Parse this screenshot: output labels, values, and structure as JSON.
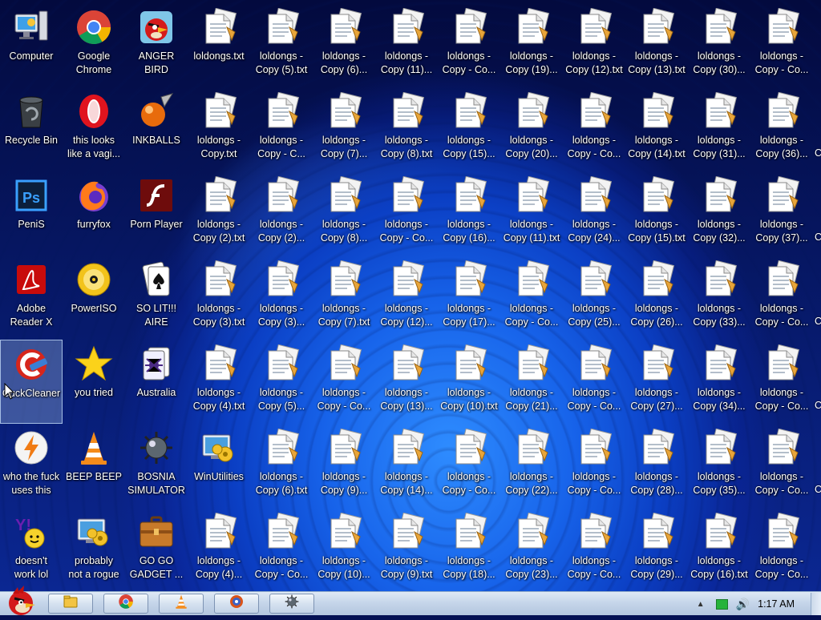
{
  "desktop": {
    "app_icons": [
      {
        "label": "Computer",
        "icon": "computer-icon",
        "col": 0,
        "row": 0
      },
      {
        "label": "Recycle Bin",
        "icon": "recycle-bin-icon",
        "col": 0,
        "row": 1
      },
      {
        "label": "PeniS",
        "icon": "photoshop-icon",
        "col": 0,
        "row": 2
      },
      {
        "label": "Adobe\nReader X",
        "icon": "adobe-reader-icon",
        "col": 0,
        "row": 3
      },
      {
        "label": "CuckCleaner",
        "icon": "ccleaner-icon",
        "col": 0,
        "row": 4,
        "selected": true
      },
      {
        "label": "who the fuck\nuses this",
        "icon": "winamp-icon",
        "col": 0,
        "row": 5
      },
      {
        "label": "doesn't\nwork lol",
        "icon": "yahoo-messenger-icon",
        "col": 0,
        "row": 6
      },
      {
        "label": "Google\nChrome",
        "icon": "chrome-icon",
        "col": 1,
        "row": 0
      },
      {
        "label": "this looks\nlike a vagi...",
        "icon": "opera-icon",
        "col": 1,
        "row": 1
      },
      {
        "label": "furryfox",
        "icon": "firefox-icon",
        "col": 1,
        "row": 2
      },
      {
        "label": "PowerISO",
        "icon": "poweriso-icon",
        "col": 1,
        "row": 3
      },
      {
        "label": "you tried",
        "icon": "star-icon",
        "col": 1,
        "row": 4
      },
      {
        "label": "BEEP BEEP",
        "icon": "vlc-icon",
        "col": 1,
        "row": 5
      },
      {
        "label": "probably\nnot a rogue",
        "icon": "utility-icon",
        "col": 1,
        "row": 6
      },
      {
        "label": "ANGER\nBIRD",
        "icon": "angry-birds-icon",
        "col": 2,
        "row": 0
      },
      {
        "label": "INKBALLS",
        "icon": "inkball-icon",
        "col": 2,
        "row": 1
      },
      {
        "label": "Porn Player",
        "icon": "flash-player-icon",
        "col": 2,
        "row": 2
      },
      {
        "label": "SO LIT!!!\nAIRE",
        "icon": "solitaire-icon",
        "col": 2,
        "row": 3
      },
      {
        "label": "Australia",
        "icon": "spider-solitaire-icon",
        "col": 2,
        "row": 4
      },
      {
        "label": "BOSNIA\nSIMULATOR",
        "icon": "minesweeper-icon",
        "col": 2,
        "row": 5
      },
      {
        "label": "GO GO\nGADGET ...",
        "icon": "briefcase-icon",
        "col": 2,
        "row": 6
      },
      {
        "label": "WinUtilities",
        "icon": "utility-icon",
        "col": 3,
        "row": 5
      }
    ],
    "file_columns": [
      {
        "col": 3,
        "rows": [
          0,
          1,
          2,
          3,
          4,
          6
        ],
        "labels": [
          "loldongs.txt",
          "loldongs -\nCopy.txt",
          "loldongs -\nCopy (2).txt",
          "loldongs -\nCopy (3).txt",
          "loldongs -\nCopy (4).txt",
          "loldongs -\nCopy (4)..."
        ]
      },
      {
        "col": 4,
        "rows": [
          0,
          1,
          2,
          3,
          4,
          5,
          6
        ],
        "labels": [
          "loldongs -\nCopy (5).txt",
          "loldongs -\nCopy - C...",
          "loldongs -\nCopy (2)...",
          "loldongs -\nCopy (3)...",
          "loldongs -\nCopy (5)...",
          "loldongs -\nCopy (6).txt",
          "loldongs -\nCopy - Co..."
        ]
      },
      {
        "col": 5,
        "rows": [
          0,
          1,
          2,
          3,
          4,
          5,
          6
        ],
        "labels": [
          "loldongs -\nCopy (6)...",
          "loldongs -\nCopy (7)...",
          "loldongs -\nCopy (8)...",
          "loldongs -\nCopy (7).txt",
          "loldongs -\nCopy - Co...",
          "loldongs -\nCopy (9)...",
          "loldongs -\nCopy (10)..."
        ]
      },
      {
        "col": 6,
        "rows": [
          0,
          1,
          2,
          3,
          4,
          5,
          6
        ],
        "labels": [
          "loldongs -\nCopy (11)...",
          "loldongs -\nCopy (8).txt",
          "loldongs -\nCopy - Co...",
          "loldongs -\nCopy (12)...",
          "loldongs -\nCopy (13)...",
          "loldongs -\nCopy (14)...",
          "loldongs -\nCopy (9).txt"
        ]
      },
      {
        "col": 7,
        "rows": [
          0,
          1,
          2,
          3,
          4,
          5,
          6
        ],
        "labels": [
          "loldongs -\nCopy - Co...",
          "loldongs -\nCopy (15)...",
          "loldongs -\nCopy (16)...",
          "loldongs -\nCopy (17)...",
          "loldongs -\nCopy (10).txt",
          "loldongs -\nCopy - Co...",
          "loldongs -\nCopy (18)..."
        ]
      },
      {
        "col": 8,
        "rows": [
          0,
          1,
          2,
          3,
          4,
          5,
          6
        ],
        "labels": [
          "loldongs -\nCopy (19)...",
          "loldongs -\nCopy (20)...",
          "loldongs -\nCopy (11).txt",
          "loldongs -\nCopy - Co...",
          "loldongs -\nCopy (21)...",
          "loldongs -\nCopy (22)...",
          "loldongs -\nCopy (23)..."
        ]
      },
      {
        "col": 9,
        "rows": [
          0,
          1,
          2,
          3,
          4,
          5,
          6
        ],
        "labels": [
          "loldongs -\nCopy (12).txt",
          "loldongs -\nCopy - Co...",
          "loldongs -\nCopy (24)...",
          "loldongs -\nCopy (25)...",
          "loldongs -\nCopy - Co...",
          "loldongs -\nCopy - Co...",
          "loldongs -\nCopy - Co..."
        ]
      },
      {
        "col": 10,
        "rows": [
          0,
          1,
          2,
          3,
          4,
          5,
          6
        ],
        "labels": [
          "loldongs -\nCopy (13).txt",
          "loldongs -\nCopy (14).txt",
          "loldongs -\nCopy (15).txt",
          "loldongs -\nCopy (26)...",
          "loldongs -\nCopy (27)...",
          "loldongs -\nCopy (28)...",
          "loldongs -\nCopy (29)..."
        ]
      },
      {
        "col": 11,
        "rows": [
          0,
          1,
          2,
          3,
          4,
          5,
          6
        ],
        "labels": [
          "loldongs -\nCopy (30)...",
          "loldongs -\nCopy (31)...",
          "loldongs -\nCopy (32)...",
          "loldongs -\nCopy (33)...",
          "loldongs -\nCopy (34)...",
          "loldongs -\nCopy (35)...",
          "loldongs -\nCopy (16).txt"
        ]
      },
      {
        "col": 12,
        "rows": [
          0,
          1,
          2,
          3,
          4,
          5,
          6
        ],
        "labels": [
          "loldongs -\nCopy - Co...",
          "loldongs -\nCopy (36)...",
          "loldongs -\nCopy (37)...",
          "loldongs -\nCopy - Co...",
          "loldongs -\nCopy - Co...",
          "loldongs -\nCopy - Co...",
          "loldongs -\nCopy - Co..."
        ]
      }
    ],
    "edge_fragments": [
      "C",
      "C",
      "C",
      "C",
      "C"
    ]
  },
  "taskbar": {
    "pinned": [
      {
        "icon": "explorer-icon"
      },
      {
        "icon": "chrome-icon"
      },
      {
        "icon": "vlc-icon"
      },
      {
        "icon": "media-player-icon"
      },
      {
        "icon": "minesweeper-icon"
      }
    ],
    "clock": "1:17 AM"
  },
  "colors": {
    "accent": "#1763ea",
    "taskbar": "#c6d6ea"
  }
}
